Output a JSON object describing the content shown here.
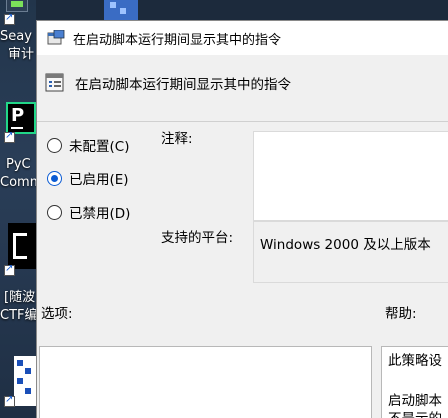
{
  "desktop": {
    "icons": [
      {
        "name": "Seay",
        "label_lines": [
          "Seay",
          "审计"
        ]
      },
      {
        "name": "PyCharm",
        "label_lines": [
          "PyC",
          "Comm"
        ]
      },
      {
        "name": "ctf-tool",
        "label_lines": [
          "[随波",
          "CTF编"
        ]
      }
    ]
  },
  "window": {
    "title": "在启动脚本运行期间显示其中的指令",
    "heading": "在启动脚本运行期间显示其中的指令",
    "radio_options": [
      {
        "label": "未配置(C)",
        "checked": false
      },
      {
        "label": "已启用(E)",
        "checked": true
      },
      {
        "label": "已禁用(D)",
        "checked": false
      }
    ],
    "comment_label": "注释:",
    "comment_value": "",
    "platform_label": "支持的平台:",
    "platform_value": "Windows 2000 及以上版本",
    "options_label": "选项:",
    "help_label": "帮助:",
    "help_lines": [
      "此策略设",
      "",
      "启动脚本",
      "不是示的"
    ],
    "accent_color": "#0b5bd3"
  }
}
